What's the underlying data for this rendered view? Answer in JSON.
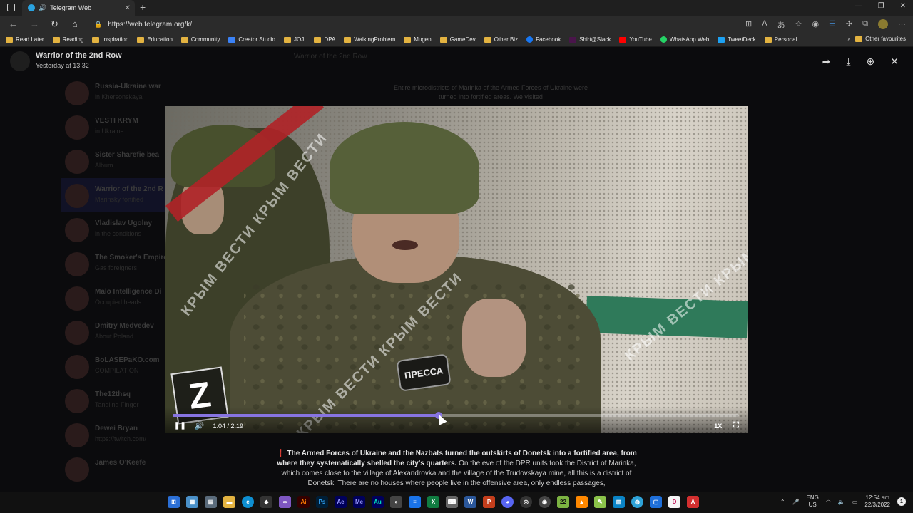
{
  "browser": {
    "tab_title": "Telegram Web",
    "url": "https://web.telegram.org/k/",
    "bookmarks": [
      "Read Later",
      "Reading",
      "Inspiration",
      "Education",
      "Community",
      "Creator Studio",
      "JOJI",
      "DPA",
      "WalkingProblem",
      "Mugen",
      "GameDev",
      "Other Biz",
      "Facebook",
      "Shirt@Slack",
      "YouTube",
      "WhatsApp Web",
      "TweetDeck",
      "Personal"
    ],
    "other_favourites": "Other favourites"
  },
  "viewer": {
    "channel_name": "Warrior of the 2nd Row",
    "posted": "Yesterday at 13:32"
  },
  "background": {
    "mid_title": "Warrior of the 2nd Row",
    "snippet": "Entire microdistricts of Marinka of the Armed Forces of Ukraine were turned into fortified areas. We visited",
    "chats": [
      {
        "name": "Russia-Ukraine war",
        "preview": "in Khersonskaya"
      },
      {
        "name": "VESTI KRYM",
        "preview": "in Ukraine"
      },
      {
        "name": "Sister Sharefie bea",
        "preview": "Album"
      },
      {
        "name": "Warrior of the 2nd R",
        "preview": "Marinsky fortified"
      },
      {
        "name": "Vladislav Ugolny",
        "preview": "in the conditions"
      },
      {
        "name": "The Smoker's Empire",
        "preview": "Gas foreigners"
      },
      {
        "name": "Malo Intelligence Di",
        "preview": "Occupied heads"
      },
      {
        "name": "Dmitry Medvedev",
        "preview": "About Poland"
      },
      {
        "name": "BoLASEPaKO.com",
        "preview": "COMPILATION"
      },
      {
        "name": "The12thsq",
        "preview": "Tangling Finger"
      },
      {
        "name": "Dewei Bryan",
        "preview": "https://twitch.com/"
      },
      {
        "name": "James O'Keefe",
        "preview": ""
      }
    ]
  },
  "video": {
    "badge_text": "ПРЕССА",
    "watermark_text": "КРЫМ ВЕСТИ КРЫМ ВЕСТИ",
    "time": "1:04 / 2:19",
    "progress_fraction": 0.47,
    "speed": "1X"
  },
  "caption": {
    "bold": "The Armed Forces of Ukraine and the Nazbats turned the outskirts of Donetsk into a fortified area, from where they systematically shelled the city's quarters.",
    "rest": " On the eve of the DPR units took the District of Marinka, which comes close to the village of Alexandrovka and the village of the Trudovskaya mine, all this is a district of Donetsk. There are no houses where people live in the offensive area, only endless passages,"
  },
  "taskbar": {
    "apps": [
      {
        "label": "Ai",
        "color": "#ff7c00"
      },
      {
        "label": "Ps",
        "color": "#31a8ff"
      },
      {
        "label": "Ae",
        "color": "#9999ff"
      },
      {
        "label": "Me",
        "color": "#9999ff"
      },
      {
        "label": "Au",
        "color": "#00e4bb"
      },
      {
        "label": "22",
        "color": "#7cb342"
      }
    ],
    "lang_top": "ENG",
    "lang_bottom": "US",
    "time": "12:54 am",
    "date": "22/3/2022",
    "notif_count": "1"
  },
  "colors": {
    "accent": "#8774e1",
    "overlay": "#000000"
  }
}
